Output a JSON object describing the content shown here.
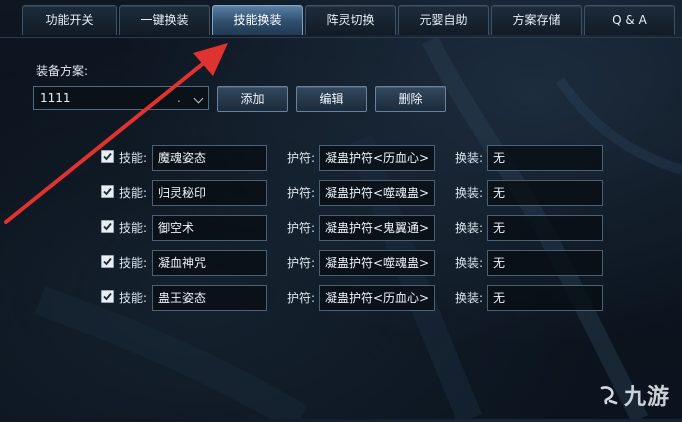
{
  "tabs": [
    {
      "label": "功能开关",
      "active": false
    },
    {
      "label": "一键换装",
      "active": false
    },
    {
      "label": "技能换装",
      "active": true
    },
    {
      "label": "阵灵切换",
      "active": false
    },
    {
      "label": "元婴自助",
      "active": false
    },
    {
      "label": "方案存储",
      "active": false
    },
    {
      "label": "Q & A",
      "active": false
    }
  ],
  "scheme": {
    "label": "装备方案:",
    "selected": "1111",
    "add_label": "添加",
    "edit_label": "编辑",
    "delete_label": "删除"
  },
  "rows": [
    {
      "checked": true,
      "skill_label": "技能:",
      "skill": "魔魂姿态",
      "talisman_label": "护符:",
      "talisman": "凝蛊护符<历血心>",
      "swap_label": "换装:",
      "swap": "无"
    },
    {
      "checked": true,
      "skill_label": "技能:",
      "skill": "归灵秘印",
      "talisman_label": "护符:",
      "talisman": "凝蛊护符<噬魂蛊>",
      "swap_label": "换装:",
      "swap": "无"
    },
    {
      "checked": true,
      "skill_label": "技能:",
      "skill": "御空术",
      "talisman_label": "护符:",
      "talisman": "凝蛊护符<鬼翼通>",
      "swap_label": "换装:",
      "swap": "无"
    },
    {
      "checked": true,
      "skill_label": "技能:",
      "skill": "凝血神咒",
      "talisman_label": "护符:",
      "talisman": "凝蛊护符<噬魂蛊>",
      "swap_label": "换装:",
      "swap": "无"
    },
    {
      "checked": true,
      "skill_label": "技能:",
      "skill": "蛊王姿态",
      "talisman_label": "护符:",
      "talisman": "凝蛊护符<历血心>",
      "swap_label": "换装:",
      "swap": "无"
    }
  ],
  "watermark": {
    "text": "九游"
  },
  "colors": {
    "arrow": "#e0322f",
    "active_tab": "#4a6f94"
  },
  "icons": {
    "checkbox": "check-icon",
    "dropdown": "chevron-down-icon",
    "annotation": "red-arrow-icon",
    "watermark": "jiuyou-logo-icon"
  }
}
